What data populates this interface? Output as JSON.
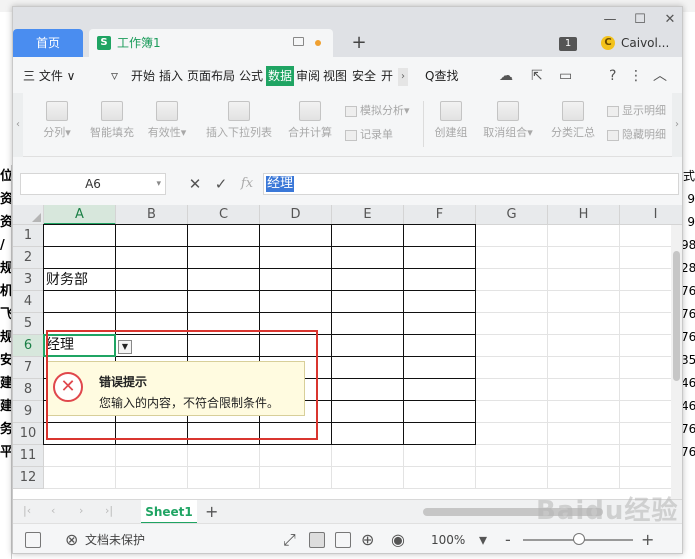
{
  "titlebar": {
    "home_tab": "首页",
    "doc_icon": "S",
    "doc_tab": "工作簿1",
    "add_tab": "+",
    "badge": "1",
    "user_initial": "C",
    "user_name": "Caivol..."
  },
  "menu": {
    "file": "三 文件 ∨",
    "items": [
      "开始",
      "插入",
      "页面布局",
      "公式",
      "数据",
      "审阅",
      "视图",
      "安全",
      "开"
    ],
    "active_item": "数据",
    "search": "Q查找"
  },
  "ribbon": {
    "buttons": [
      "分列",
      "智能填充",
      "有效性",
      "插入下拉列表",
      "合并计算",
      "创建组",
      "取消组合",
      "分类汇总"
    ],
    "small_buttons": [
      "模拟分析",
      "记录单",
      "显示明细",
      "隐藏明细"
    ]
  },
  "formula_bar": {
    "name_box": "A6",
    "value": "经理"
  },
  "grid": {
    "columns": [
      "A",
      "B",
      "C",
      "D",
      "E",
      "F",
      "G",
      "H",
      "I"
    ],
    "rows": [
      "1",
      "2",
      "3",
      "4",
      "5",
      "6",
      "7",
      "8",
      "9",
      "10",
      "11",
      "12"
    ],
    "active_column": "A",
    "active_row": "6",
    "cells": {
      "A3": "财务部",
      "A6": "经理"
    }
  },
  "error_tip": {
    "title": "错误提示",
    "message": "您输入的内容，不符合限制条件。"
  },
  "sheets": {
    "tabs": [
      "Sheet1"
    ],
    "add": "+"
  },
  "status": {
    "protect": "文档未保护",
    "zoom": "100%",
    "zoom_minus": "-",
    "zoom_plus": "+"
  },
  "backdrop": {
    "left_chars": [
      "位",
      "资",
      "资",
      "/",
      "规",
      "机",
      "飞",
      "规",
      "安",
      "建",
      "建",
      "务",
      "平"
    ],
    "right_chars": [
      "式",
      "9",
      "9",
      "98",
      "28",
      "76",
      "76",
      "76",
      "35",
      "46",
      "46",
      "76",
      "76"
    ]
  },
  "watermark": "Baidu经验"
}
